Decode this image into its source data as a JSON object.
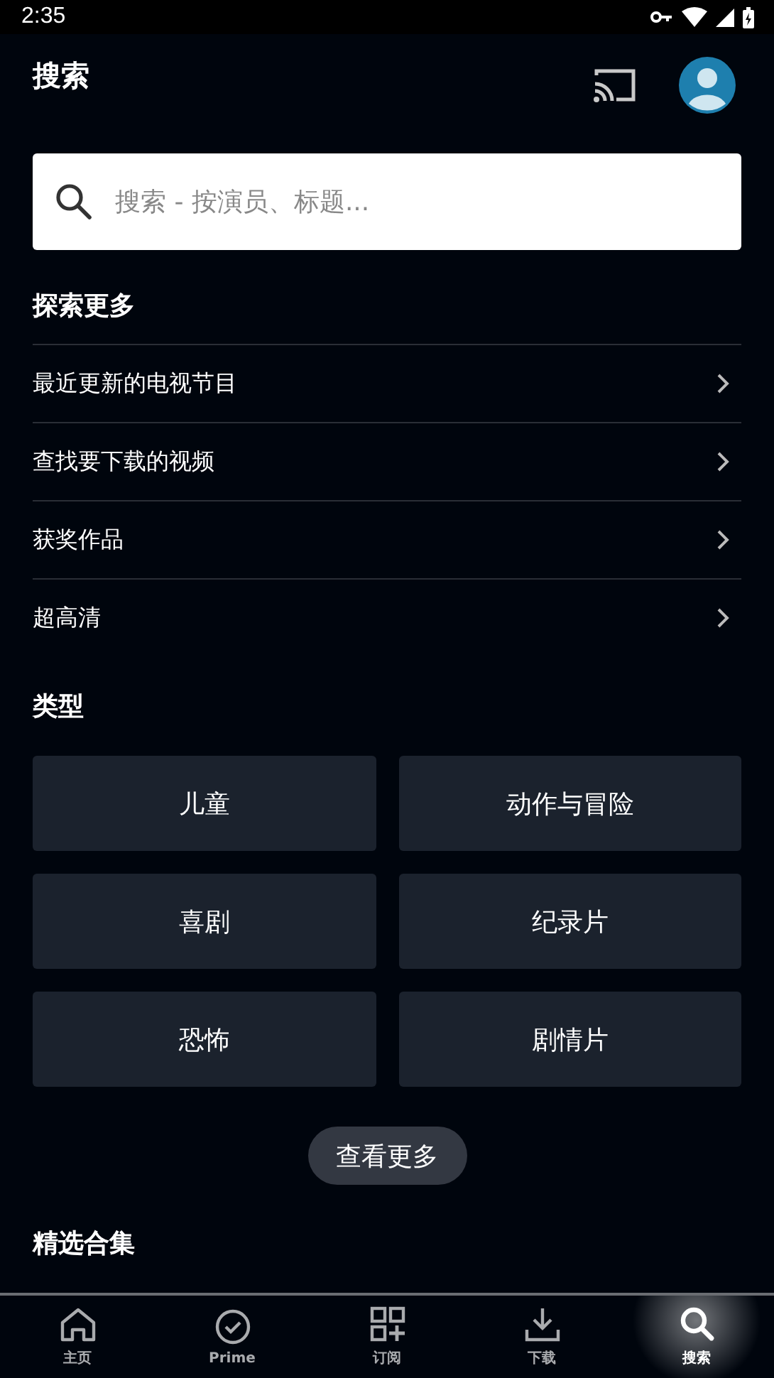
{
  "status_bar": {
    "time": "2:35"
  },
  "header": {
    "title": "搜索"
  },
  "search": {
    "placeholder": "搜索 - 按演员、标题..."
  },
  "explore": {
    "title": "探索更多",
    "items": [
      {
        "label": "最近更新的电视节目"
      },
      {
        "label": "查找要下载的视频"
      },
      {
        "label": "获奖作品"
      },
      {
        "label": "超高清"
      }
    ]
  },
  "genres": {
    "title": "类型",
    "items": [
      "儿童",
      "动作与冒险",
      "喜剧",
      "纪录片",
      "恐怖",
      "剧情片"
    ],
    "more_button": "查看更多"
  },
  "collections": {
    "title": "精选合集"
  },
  "bottom_nav": [
    {
      "kind": "home",
      "label": "主页",
      "selected": false
    },
    {
      "kind": "prime",
      "label": "Prime",
      "selected": false
    },
    {
      "kind": "subscriptions",
      "label": "订阅",
      "selected": false
    },
    {
      "kind": "download",
      "label": "下载",
      "selected": false
    },
    {
      "kind": "search",
      "label": "搜索",
      "selected": true
    }
  ]
}
